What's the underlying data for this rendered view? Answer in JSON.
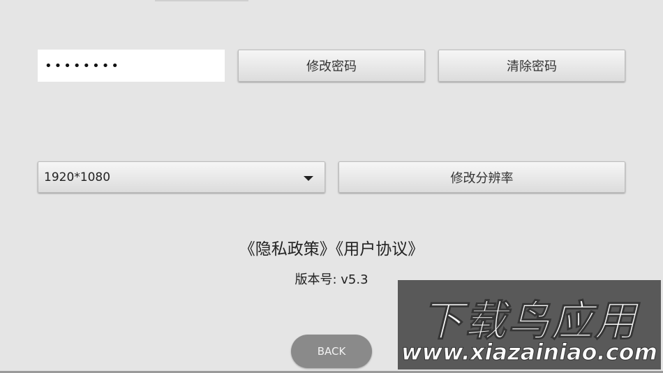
{
  "password": {
    "value": "12345678",
    "change_button": "修改密码",
    "clear_button": "清除密码"
  },
  "resolution": {
    "selected": "1920*1080",
    "change_button": "修改分辨率",
    "arrow_icon": "caret-down-icon"
  },
  "links": {
    "privacy": "《隐私政策》",
    "agreement": "《用户协议》"
  },
  "version": {
    "text": "版本号: v5.3"
  },
  "back_button": "BACK",
  "watermark": {
    "title": "下载鸟应用",
    "url": "www.xiazainiao.com"
  },
  "colors": {
    "background": "#e5e5e5",
    "back_button": "#8a8a8a"
  }
}
